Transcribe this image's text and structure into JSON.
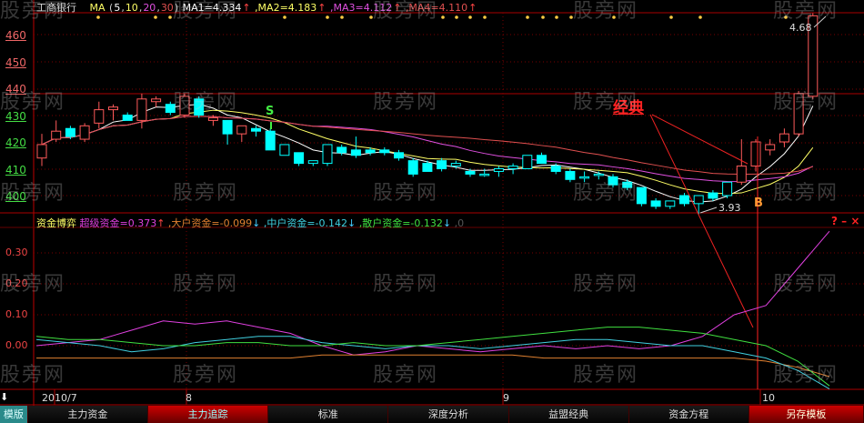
{
  "stock_name": "工商银行",
  "ma_header": {
    "label": "MA",
    "p_open": " (",
    "p5": "5",
    "c1": ",",
    "p10": "10",
    "c2": ",",
    "p20": "20",
    "c3": ",",
    "p30": "30",
    "p_close": ")",
    "ma1": " MA1=4.334",
    "ma1_arrow": "↑",
    "ma2": " ,MA2=4.183",
    "ma2_arrow": "↑",
    "ma3": " ,MA3=4.112",
    "ma3_arrow": "↑",
    "ma4": " ,MA4=4.110",
    "ma4_arrow": "↑"
  },
  "indicator_header": {
    "name": "资金博弈",
    "super": " 超级资金=0.373",
    "super_arrow": "↑",
    "big": " ,大户资金=-0.099",
    "big_arrow": "↓",
    "mid": " ,中户资金=-0.142",
    "mid_arrow": "↓",
    "retail": " ,散户资金=-0.132",
    "retail_arrow": "↓",
    "tail": " ,0"
  },
  "window_controls": {
    "help": "?",
    "minimize": "–",
    "close": "×"
  },
  "price_axis": [
    "460",
    "450",
    "440",
    "430",
    "420",
    "410",
    "400"
  ],
  "indicator_axis": [
    "0.30",
    "0.20",
    "0.10",
    "0.00"
  ],
  "date_axis": {
    "d1": "2010/7",
    "d2": "8",
    "d3": "9",
    "d4": "10"
  },
  "annotations": {
    "classic": "经典",
    "sell": "S",
    "buy": "B",
    "high_label": "4.68",
    "low_label": "3.93"
  },
  "watermark": "股旁网",
  "tabs": [
    {
      "label": "模版"
    },
    {
      "label": "主力资金"
    },
    {
      "label": "主力追踪"
    },
    {
      "label": "标准"
    },
    {
      "label": "深度分析"
    },
    {
      "label": "益盟经典"
    },
    {
      "label": "资金方程"
    },
    {
      "label": "另存模板"
    }
  ],
  "colors": {
    "up": "#ff5a5a",
    "down": "#00ffff",
    "ma5": "#ffffff",
    "ma10": "#ffff66",
    "ma20": "#e050e0",
    "ma30": "#e05050",
    "super": "#e040e0",
    "big": "#e08030",
    "mid": "#40d0e0",
    "retail": "#40e040"
  },
  "chart_data": {
    "type": "candlestick",
    "sell_index": 16,
    "buy_index": 49,
    "candles": [
      [
        4.14,
        4.23,
        4.11,
        4.19
      ],
      [
        4.21,
        4.28,
        4.2,
        4.24
      ],
      [
        4.25,
        4.26,
        4.21,
        4.22
      ],
      [
        4.21,
        4.27,
        4.2,
        4.26
      ],
      [
        4.27,
        4.35,
        4.25,
        4.32
      ],
      [
        4.32,
        4.34,
        4.28,
        4.33
      ],
      [
        4.3,
        4.31,
        4.28,
        4.28
      ],
      [
        4.28,
        4.38,
        4.25,
        4.36
      ],
      [
        4.35,
        4.37,
        4.33,
        4.36
      ],
      [
        4.34,
        4.35,
        4.3,
        4.31
      ],
      [
        4.3,
        4.38,
        4.29,
        4.37
      ],
      [
        4.36,
        4.37,
        4.29,
        4.3
      ],
      [
        4.28,
        4.3,
        4.26,
        4.29
      ],
      [
        4.28,
        4.28,
        4.19,
        4.23
      ],
      [
        4.23,
        4.26,
        4.2,
        4.26
      ],
      [
        4.25,
        4.26,
        4.22,
        4.24
      ],
      [
        4.24,
        4.25,
        4.17,
        4.17
      ],
      [
        4.15,
        4.19,
        4.15,
        4.19
      ],
      [
        4.16,
        4.16,
        4.11,
        4.12
      ],
      [
        4.12,
        4.13,
        4.11,
        4.13
      ],
      [
        4.12,
        4.19,
        4.11,
        4.19
      ],
      [
        4.18,
        4.19,
        4.15,
        4.16
      ],
      [
        4.17,
        4.22,
        4.14,
        4.15
      ],
      [
        4.17,
        4.18,
        4.15,
        4.16
      ],
      [
        4.17,
        4.18,
        4.15,
        4.16
      ],
      [
        4.16,
        4.17,
        4.13,
        4.14
      ],
      [
        4.13,
        4.14,
        4.07,
        4.08
      ],
      [
        4.12,
        4.13,
        4.09,
        4.09
      ],
      [
        4.13,
        4.14,
        4.09,
        4.1
      ],
      [
        4.11,
        4.13,
        4.1,
        4.12
      ],
      [
        4.09,
        4.1,
        4.07,
        4.08
      ],
      [
        4.08,
        4.1,
        4.07,
        4.08
      ],
      [
        4.09,
        4.11,
        4.07,
        4.1
      ],
      [
        4.1,
        4.12,
        4.08,
        4.11
      ],
      [
        4.1,
        4.15,
        4.1,
        4.15
      ],
      [
        4.15,
        4.16,
        4.12,
        4.12
      ],
      [
        4.11,
        4.12,
        4.08,
        4.09
      ],
      [
        4.09,
        4.1,
        4.05,
        4.06
      ],
      [
        4.07,
        4.09,
        4.05,
        4.07
      ],
      [
        4.08,
        4.09,
        4.06,
        4.08
      ],
      [
        4.07,
        4.08,
        4.03,
        4.04
      ],
      [
        4.05,
        4.06,
        4.02,
        4.03
      ],
      [
        4.03,
        4.03,
        3.96,
        3.97
      ],
      [
        3.98,
        3.99,
        3.95,
        3.96
      ],
      [
        3.96,
        3.98,
        3.95,
        3.98
      ],
      [
        4.0,
        4.01,
        3.96,
        3.97
      ],
      [
        3.97,
        4.0,
        3.93,
        4.0
      ],
      [
        4.01,
        4.02,
        3.98,
        3.99
      ],
      [
        4.0,
        4.05,
        3.99,
        4.05
      ],
      [
        4.05,
        4.21,
        4.04,
        4.11
      ],
      [
        4.11,
        4.21,
        4.09,
        4.2
      ],
      [
        4.17,
        4.21,
        4.15,
        4.19
      ],
      [
        4.2,
        4.25,
        4.18,
        4.23
      ],
      [
        4.23,
        4.39,
        4.22,
        4.38
      ],
      [
        4.37,
        4.68,
        4.36,
        4.67
      ]
    ],
    "indicator_series": [
      {
        "name": "超级资金",
        "values": [
          0.0,
          0.01,
          0.02,
          0.05,
          0.08,
          0.07,
          0.08,
          0.06,
          0.04,
          0.0,
          -0.03,
          -0.02,
          0.0,
          -0.01,
          -0.02,
          -0.01,
          0.0,
          -0.01,
          0.0,
          -0.01,
          0.0,
          0.03,
          0.1,
          0.13,
          0.25,
          0.37
        ]
      },
      {
        "name": "大户资金",
        "values": [
          -0.04,
          -0.04,
          -0.04,
          -0.04,
          -0.04,
          -0.04,
          -0.04,
          -0.04,
          -0.04,
          -0.03,
          -0.03,
          -0.03,
          -0.03,
          -0.03,
          -0.03,
          -0.03,
          -0.04,
          -0.04,
          -0.04,
          -0.04,
          -0.04,
          -0.04,
          -0.04,
          -0.05,
          -0.07,
          -0.1
        ]
      },
      {
        "name": "中户资金",
        "values": [
          0.02,
          0.01,
          0.0,
          -0.02,
          -0.01,
          0.01,
          0.02,
          0.03,
          0.03,
          0.01,
          0.0,
          -0.01,
          0.0,
          0.0,
          -0.01,
          0.0,
          0.01,
          0.02,
          0.02,
          0.01,
          0.0,
          0.0,
          -0.02,
          -0.04,
          -0.08,
          -0.14
        ]
      },
      {
        "name": "散户资金",
        "values": [
          0.03,
          0.02,
          0.02,
          0.01,
          0.0,
          0.0,
          0.01,
          0.01,
          0.0,
          0.0,
          0.01,
          0.0,
          0.0,
          0.01,
          0.02,
          0.03,
          0.04,
          0.05,
          0.06,
          0.06,
          0.05,
          0.04,
          0.02,
          0.0,
          -0.05,
          -0.13
        ]
      }
    ],
    "price_range": [
      3.93,
      4.68
    ],
    "indicator_range": [
      -0.14,
      0.37
    ]
  }
}
